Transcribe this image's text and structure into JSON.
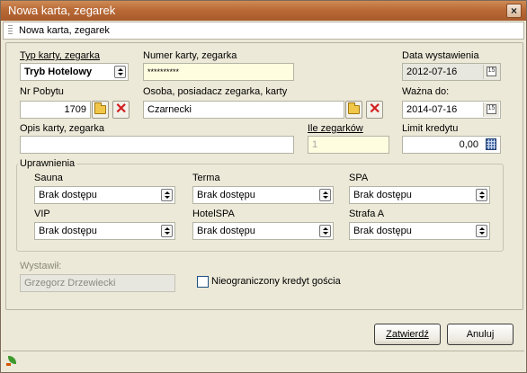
{
  "window": {
    "title": "Nowa karta, zegarek"
  },
  "tab": {
    "label": "Nowa karta, zegarek"
  },
  "form": {
    "typ_karty_label": "Typ karty, zegarka",
    "typ_karty_value": "Tryb Hotelowy",
    "numer_karty_label": "Numer karty, zegarka",
    "numer_karty_value": "**********",
    "data_wystawienia_label": "Data wystawienia",
    "data_wystawienia_value": "2012-07-16",
    "nr_pobytu_label": "Nr Pobytu",
    "nr_pobytu_value": "1709",
    "osoba_label": "Osoba, posiadacz zegarka, karty",
    "osoba_value": "Czarnecki",
    "wazna_do_label": "Ważna do:",
    "wazna_do_value": "2014-07-16",
    "opis_label": "Opis karty, zegarka",
    "opis_value": "",
    "ile_zegarkow_label": "Ile zegarków",
    "ile_zegarkow_value": "1",
    "limit_kredytu_label": "Limit kredytu",
    "limit_kredytu_value": "0,00"
  },
  "uprawnienia": {
    "title": "Uprawnienia",
    "items": [
      {
        "label": "Sauna",
        "value": "Brak dostępu"
      },
      {
        "label": "Terma",
        "value": "Brak dostępu"
      },
      {
        "label": "SPA",
        "value": "Brak dostępu"
      },
      {
        "label": "VIP",
        "value": "Brak dostępu"
      },
      {
        "label": "HotelSPA",
        "value": "Brak dostępu"
      },
      {
        "label": "Strafa A",
        "value": "Brak dostępu"
      }
    ]
  },
  "wystawil": {
    "label": "Wystawił:",
    "value": "Grzegorz Drzewiecki"
  },
  "checkbox": {
    "label": "Nieograniczony kredyt gościa",
    "checked": false
  },
  "buttons": {
    "confirm": "Zatwierdź",
    "cancel": "Anuluj"
  },
  "icons": {
    "close": "close-icon",
    "folder": "folder-icon",
    "clear": "delete-x-icon",
    "calendar": "calendar-icon",
    "calculator": "calculator-icon",
    "status": "leaf-icon"
  }
}
